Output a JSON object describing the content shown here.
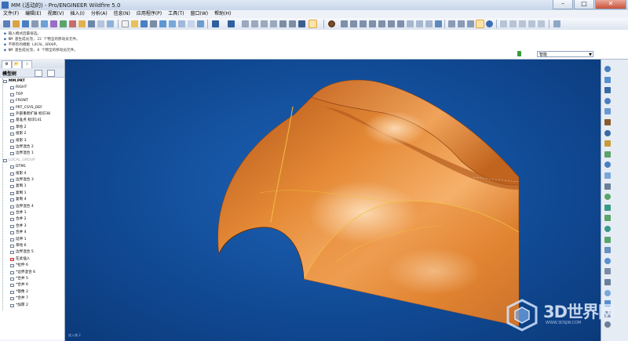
{
  "window": {
    "title": "MM (活动的) - Pro/ENGINEER Wildfire 5.0",
    "minimize": "–",
    "maximize": "□",
    "close": "✕"
  },
  "menu": [
    "文件(F)",
    "编辑(E)",
    "视图(V)",
    "插入(I)",
    "分析(A)",
    "信息(N)",
    "应用程序(P)",
    "工具(T)",
    "窗口(W)",
    "帮助(H)"
  ],
  "messages": [
    {
      "bullet": "●",
      "text": "输入模式后最很选。"
    },
    {
      "bullet": "●",
      "text": "NM 基生成光泡, 22 个物全的移动员元件。"
    },
    {
      "bullet": "●",
      "text": "不移阶的模版 LOCAL_GROUP。"
    },
    {
      "bullet": "●",
      "text": "NM 基生成光泡, 8 个物全的移动员元件。"
    }
  ],
  "filter": {
    "value": "智能",
    "arrow": "▼"
  },
  "panel": {
    "tabs": [
      "⚙",
      "📂",
      "☆"
    ],
    "tree_title": "模型树"
  },
  "tree": [
    {
      "label": "MM.PRT",
      "indent": 0,
      "style": "root"
    },
    {
      "label": "RIGHT",
      "indent": 1,
      "style": ""
    },
    {
      "label": "TOP",
      "indent": 1,
      "style": ""
    },
    {
      "label": "FRONT",
      "indent": 1,
      "style": ""
    },
    {
      "label": "PRT_CSYS_DEF",
      "indent": 1,
      "style": ""
    },
    {
      "label": "外部重新扩展 标识38",
      "indent": 1,
      "style": ""
    },
    {
      "label": "基准点 标识141",
      "indent": 1,
      "style": ""
    },
    {
      "label": "草绘 2",
      "indent": 1,
      "style": ""
    },
    {
      "label": "投影 2",
      "indent": 1,
      "style": ""
    },
    {
      "label": "投影 3",
      "indent": 1,
      "style": ""
    },
    {
      "label": "边界混合 2",
      "indent": 1,
      "style": ""
    },
    {
      "label": "边界混合 1",
      "indent": 1,
      "style": ""
    },
    {
      "label": "LOCAL_GROUP",
      "indent": 0,
      "style": "grey"
    },
    {
      "label": "DTM1",
      "indent": 1,
      "style": ""
    },
    {
      "label": "投影 4",
      "indent": 1,
      "style": ""
    },
    {
      "label": "边界混合 3",
      "indent": 1,
      "style": ""
    },
    {
      "label": "复制 1",
      "indent": 1,
      "style": ""
    },
    {
      "label": "复制 1",
      "indent": 1,
      "style": ""
    },
    {
      "label": "复制 4",
      "indent": 1,
      "style": ""
    },
    {
      "label": "边界混合 4",
      "indent": 1,
      "style": ""
    },
    {
      "label": "合并 1",
      "indent": 1,
      "style": ""
    },
    {
      "label": "合并 2",
      "indent": 1,
      "style": ""
    },
    {
      "label": "合并 3",
      "indent": 1,
      "style": ""
    },
    {
      "label": "合并 4",
      "indent": 1,
      "style": ""
    },
    {
      "label": "延伸 1",
      "indent": 1,
      "style": ""
    },
    {
      "label": "草绘 6",
      "indent": 1,
      "style": ""
    },
    {
      "label": "边界混合 5",
      "indent": 1,
      "style": ""
    },
    {
      "label": "在此插入",
      "indent": 1,
      "style": "red"
    },
    {
      "label": "*拉伸 6",
      "indent": 1,
      "style": ""
    },
    {
      "label": "*边界混合 6",
      "indent": 1,
      "style": ""
    },
    {
      "label": "*合并 5",
      "indent": 1,
      "style": ""
    },
    {
      "label": "*合并 6",
      "indent": 1,
      "style": ""
    },
    {
      "label": "*镜像 2",
      "indent": 1,
      "style": ""
    },
    {
      "label": "*合并 7",
      "indent": 1,
      "style": ""
    },
    {
      "label": "*加厚 2",
      "indent": 1,
      "style": ""
    }
  ],
  "viewport": {
    "status": "迹入域 2"
  },
  "watermark": {
    "text": "3D世界网",
    "url": "WWW.3DSJW.COM"
  },
  "colors": {
    "surface": "#e07f2c",
    "viewport_bg": "#114b96",
    "accent": "#3d6fb6"
  }
}
